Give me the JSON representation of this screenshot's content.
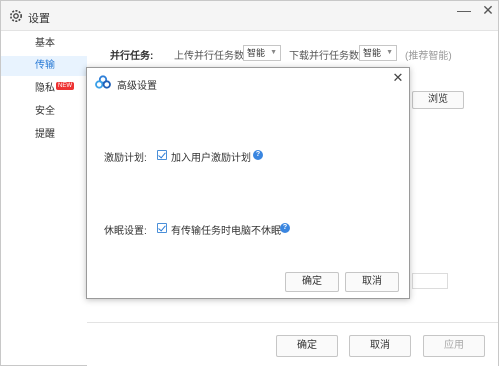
{
  "window": {
    "title": "设置",
    "minimize_symbol": "—",
    "close_symbol": "✕"
  },
  "sidebar": {
    "items": [
      {
        "label": "基本"
      },
      {
        "label": "传输",
        "active": true
      },
      {
        "label": "隐私",
        "badge": "NEW"
      },
      {
        "label": "安全"
      },
      {
        "label": "提醒"
      }
    ]
  },
  "transfer": {
    "parallel_label": "并行任务:",
    "upload_label": "上传并行任务数",
    "upload_value": "智能",
    "download_label": "下载并行任务数",
    "download_value": "智能",
    "hint": "(推荐智能)",
    "browse_label": "浏览"
  },
  "footer": {
    "ok_label": "确定",
    "cancel_label": "取消",
    "apply_label": "应用"
  },
  "dialog": {
    "title": "高级设置",
    "close_symbol": "✕",
    "incentive": {
      "label": "激励计划:",
      "checkbox_label": "加入用户激励计划",
      "checked": true
    },
    "sleep": {
      "label": "休眠设置:",
      "checkbox_label": "有传输任务时电脑不休眠",
      "checked": true
    },
    "help_symbol": "?",
    "ok_label": "确定",
    "cancel_label": "取消"
  },
  "colors": {
    "accent": "#2a7bd6",
    "active_bg": "#e8f3fe",
    "badge": "#e33333"
  }
}
